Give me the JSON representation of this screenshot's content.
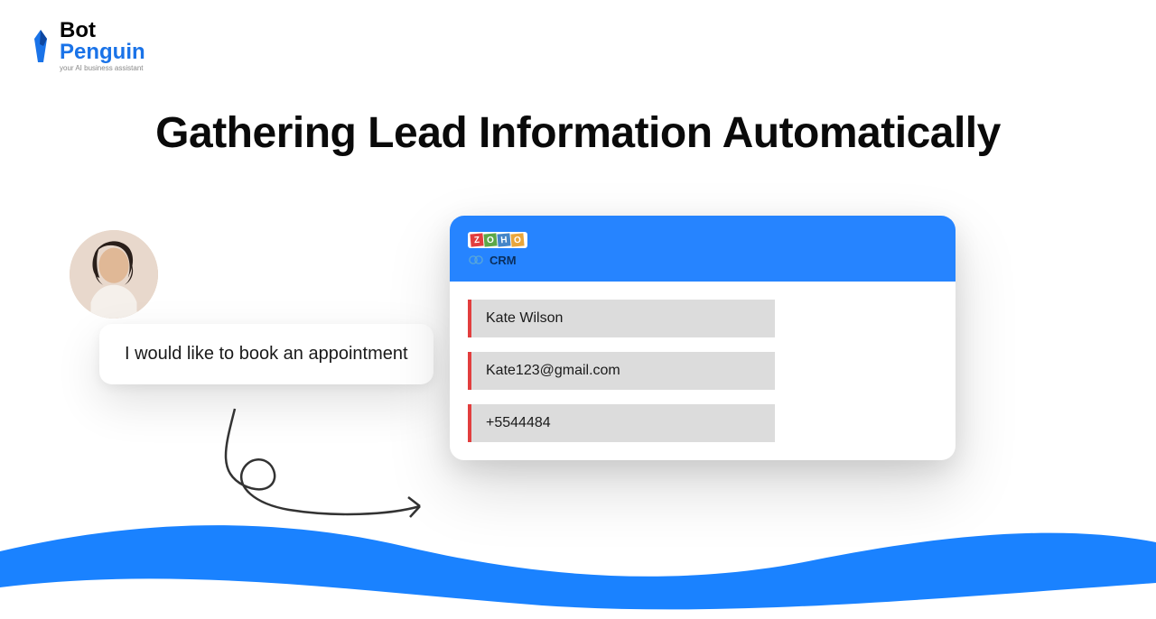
{
  "logo": {
    "line1": "Bot",
    "line2": "Penguin",
    "tagline": "your AI business assistant"
  },
  "heading": "Gathering Lead Information Automatically",
  "chat_message": "I would like to book an appointment",
  "crm": {
    "brand": "ZOHO",
    "subtitle": "CRM",
    "fields": [
      "Kate Wilson",
      "Kate123@gmail.com",
      "+5544484"
    ]
  }
}
